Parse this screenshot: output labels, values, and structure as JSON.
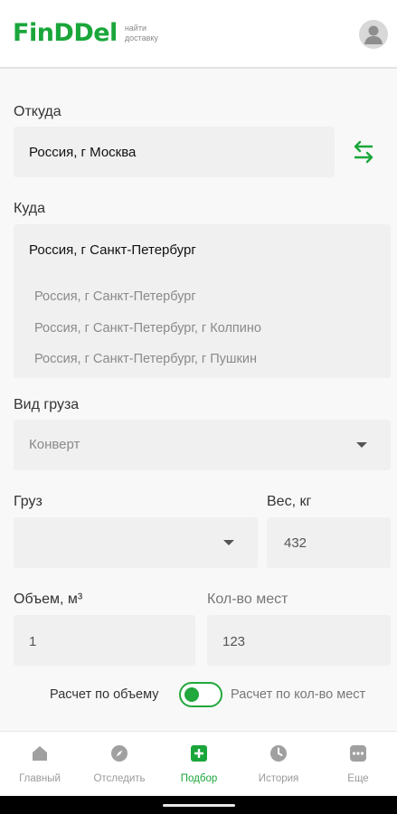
{
  "header": {
    "logo": "FinDDel",
    "tagline": "найти доставку",
    "avatar_icon": "user-avatar-icon"
  },
  "form": {
    "from": {
      "label": "Откуда",
      "value": "Россия, г Москва"
    },
    "swap_icon": "swap-arrows-icon",
    "to": {
      "label": "Куда",
      "value": "Россия, г Санкт-Петербург",
      "suggestions": [
        "Россия, г Санкт-Петербург",
        "Россия, г Санкт-Петербург, г Колпино",
        "Россия, г Санкт-Петербург, г Пушкин"
      ]
    },
    "cargo_type": {
      "label": "Вид груза",
      "value": "Конверт"
    },
    "cargo": {
      "label": "Груз",
      "value": ""
    },
    "weight": {
      "label": "Вес, кг",
      "value": "432"
    },
    "volume": {
      "label": "Объем, м³",
      "value": "1"
    },
    "places": {
      "label": "Кол-во мест",
      "value": "123"
    },
    "calc_toggle": {
      "left_label": "Расчет по объему",
      "right_label": "Расчет по кол-во мест",
      "state": "on"
    }
  },
  "nav": {
    "items": [
      {
        "label": "Главный",
        "icon": "home-icon",
        "active": false
      },
      {
        "label": "Отследить",
        "icon": "compass-icon",
        "active": false
      },
      {
        "label": "Подбор",
        "icon": "plus-square-icon",
        "active": true
      },
      {
        "label": "История",
        "icon": "clock-icon",
        "active": false
      },
      {
        "label": "Еще",
        "icon": "more-icon",
        "active": false
      }
    ]
  },
  "colors": {
    "accent": "#1aa63a",
    "field_bg": "#f0f0f0",
    "muted_text": "#8a8a8a"
  }
}
